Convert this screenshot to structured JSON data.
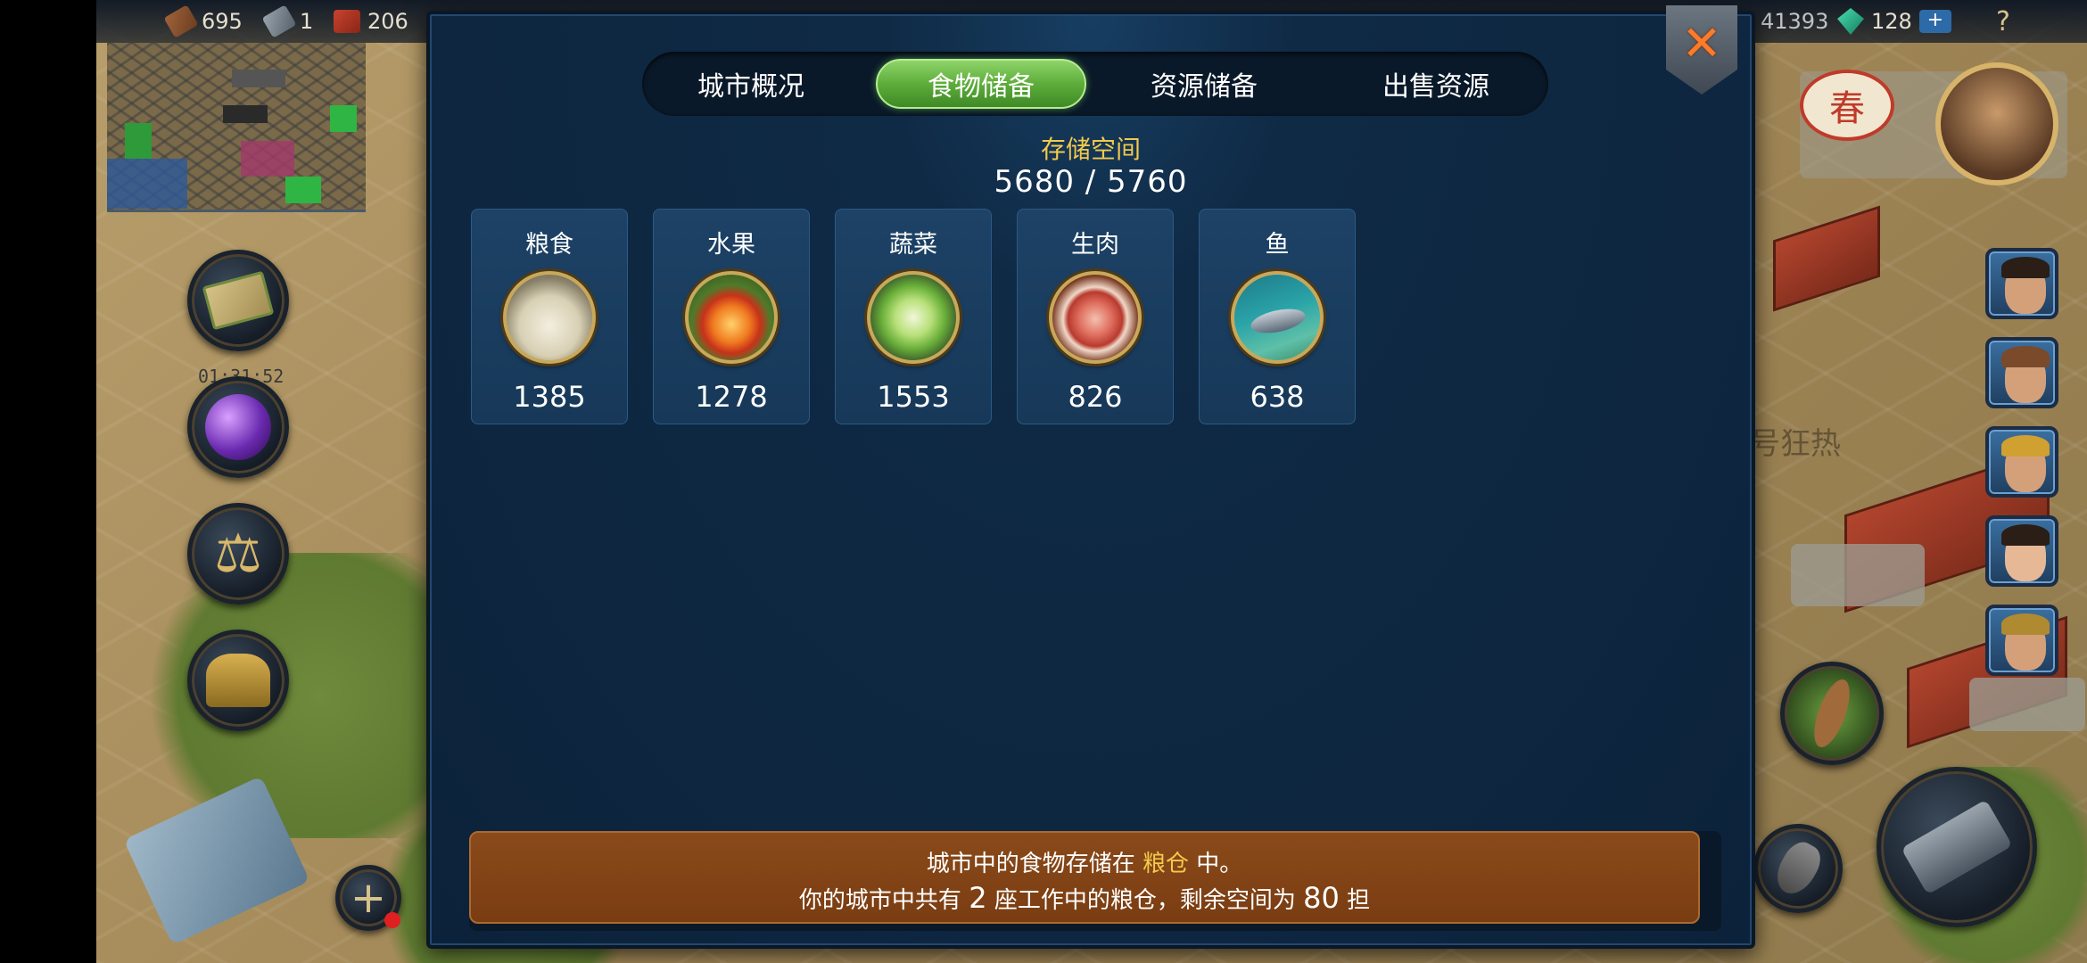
{
  "topbar": {
    "resources": [
      {
        "value": "695",
        "icon": "wood-icon"
      },
      {
        "value": "1",
        "icon": "iron-icon"
      },
      {
        "value": "206",
        "icon": "brick-icon"
      }
    ],
    "coins": "41393",
    "gems": "128",
    "add_label": "+",
    "help_label": "?"
  },
  "left": {
    "timer": "01:31:52"
  },
  "right": {
    "season_badge": "春",
    "event_text": "号狂热"
  },
  "dialog": {
    "tabs": [
      {
        "label": "城市概况",
        "active": false
      },
      {
        "label": "食物储备",
        "active": true
      },
      {
        "label": "资源储备",
        "active": false
      },
      {
        "label": "出售资源",
        "active": false
      }
    ],
    "storage_label": "存储空间",
    "storage_value": "5680 / 5760",
    "foods": [
      {
        "name": "粮食",
        "value": "1385",
        "icon": "grain-sack-icon"
      },
      {
        "name": "水果",
        "value": "1278",
        "icon": "apple-icon"
      },
      {
        "name": "蔬菜",
        "value": "1553",
        "icon": "cabbage-icon"
      },
      {
        "name": "生肉",
        "value": "826",
        "icon": "meat-icon"
      },
      {
        "name": "鱼",
        "value": "638",
        "icon": "fish-icon"
      }
    ],
    "note": {
      "line1_a": "城市中的食物存储在",
      "line1_highlight": "粮仓",
      "line1_b": "中。",
      "line2_a": "你的城市中共有",
      "line2_count": "2",
      "line2_b": "座工作中的粮仓，剩余空间为",
      "line2_space": "80",
      "line2_c": "担"
    },
    "close_icon": "close-icon"
  },
  "colors": {
    "dialog_bg": "#0e2741",
    "tab_active": "#5fae3c",
    "highlight": "#f2c94c",
    "note_bg": "#7a3d12"
  }
}
